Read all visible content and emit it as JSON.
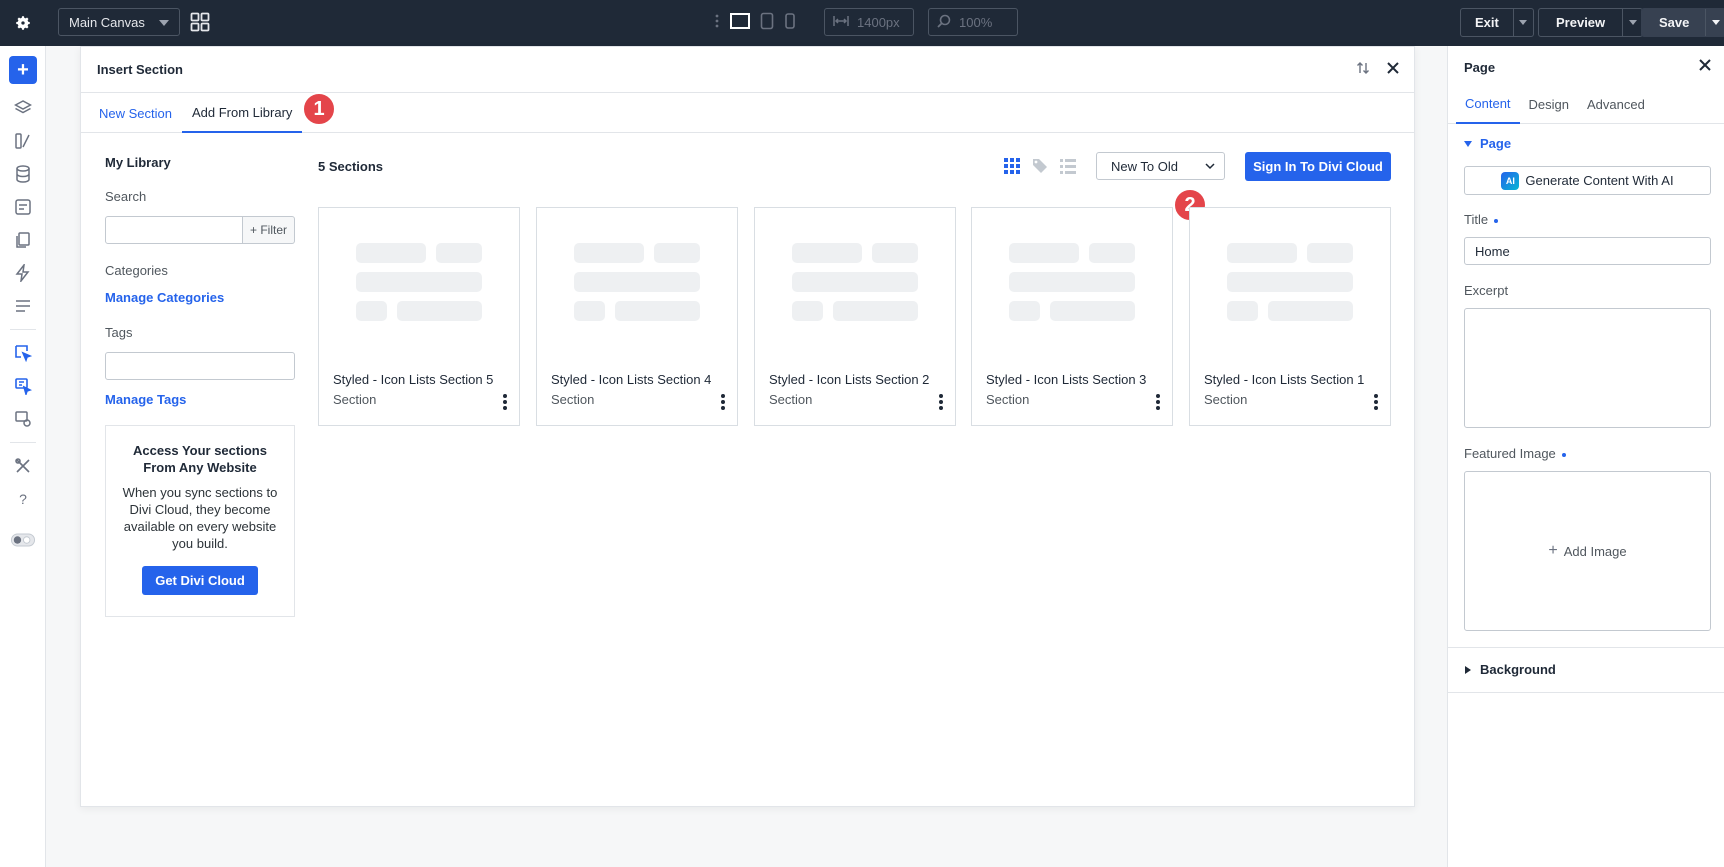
{
  "topbar": {
    "canvas_select": "Main Canvas",
    "width_value": "1400px",
    "zoom_value": "100%",
    "exit_label": "Exit",
    "preview_label": "Preview",
    "save_label": "Save"
  },
  "modal": {
    "title": "Insert Section",
    "tabs": [
      {
        "label": "New Section"
      },
      {
        "label": "Add From Library"
      }
    ],
    "badges": [
      "1",
      "2"
    ],
    "library": {
      "title": "My Library",
      "search_label": "Search",
      "filter_label": "+ Filter",
      "categories_label": "Categories",
      "manage_categories": "Manage Categories",
      "tags_label": "Tags",
      "manage_tags": "Manage Tags",
      "promo_title": "Access Your sections From Any Website",
      "promo_text": "When you sync sections to Divi Cloud, they become available on every website you build.",
      "promo_button": "Get Divi Cloud"
    },
    "section_count": "5 Sections",
    "sort_value": "New To Old",
    "cloud_button": "Sign In To Divi Cloud",
    "cards": [
      {
        "name": "Styled - Icon Lists Section 5",
        "type": "Section"
      },
      {
        "name": "Styled - Icon Lists Section 4",
        "type": "Section"
      },
      {
        "name": "Styled - Icon Lists Section 2",
        "type": "Section"
      },
      {
        "name": "Styled - Icon Lists Section 3",
        "type": "Section"
      },
      {
        "name": "Styled - Icon Lists Section 1",
        "type": "Section"
      }
    ]
  },
  "right_panel": {
    "title": "Page",
    "tabs": [
      "Content",
      "Design",
      "Advanced"
    ],
    "section_page": "Page",
    "ai_button": "Generate Content With AI",
    "ai_icon_text": "AI",
    "title_label": "Title",
    "title_value": "Home",
    "excerpt_label": "Excerpt",
    "featured_label": "Featured Image",
    "add_image": "Add Image",
    "section_background": "Background"
  },
  "colors": {
    "accent": "#2563eb",
    "badge": "#e4454a",
    "topbar": "#1f2937"
  }
}
